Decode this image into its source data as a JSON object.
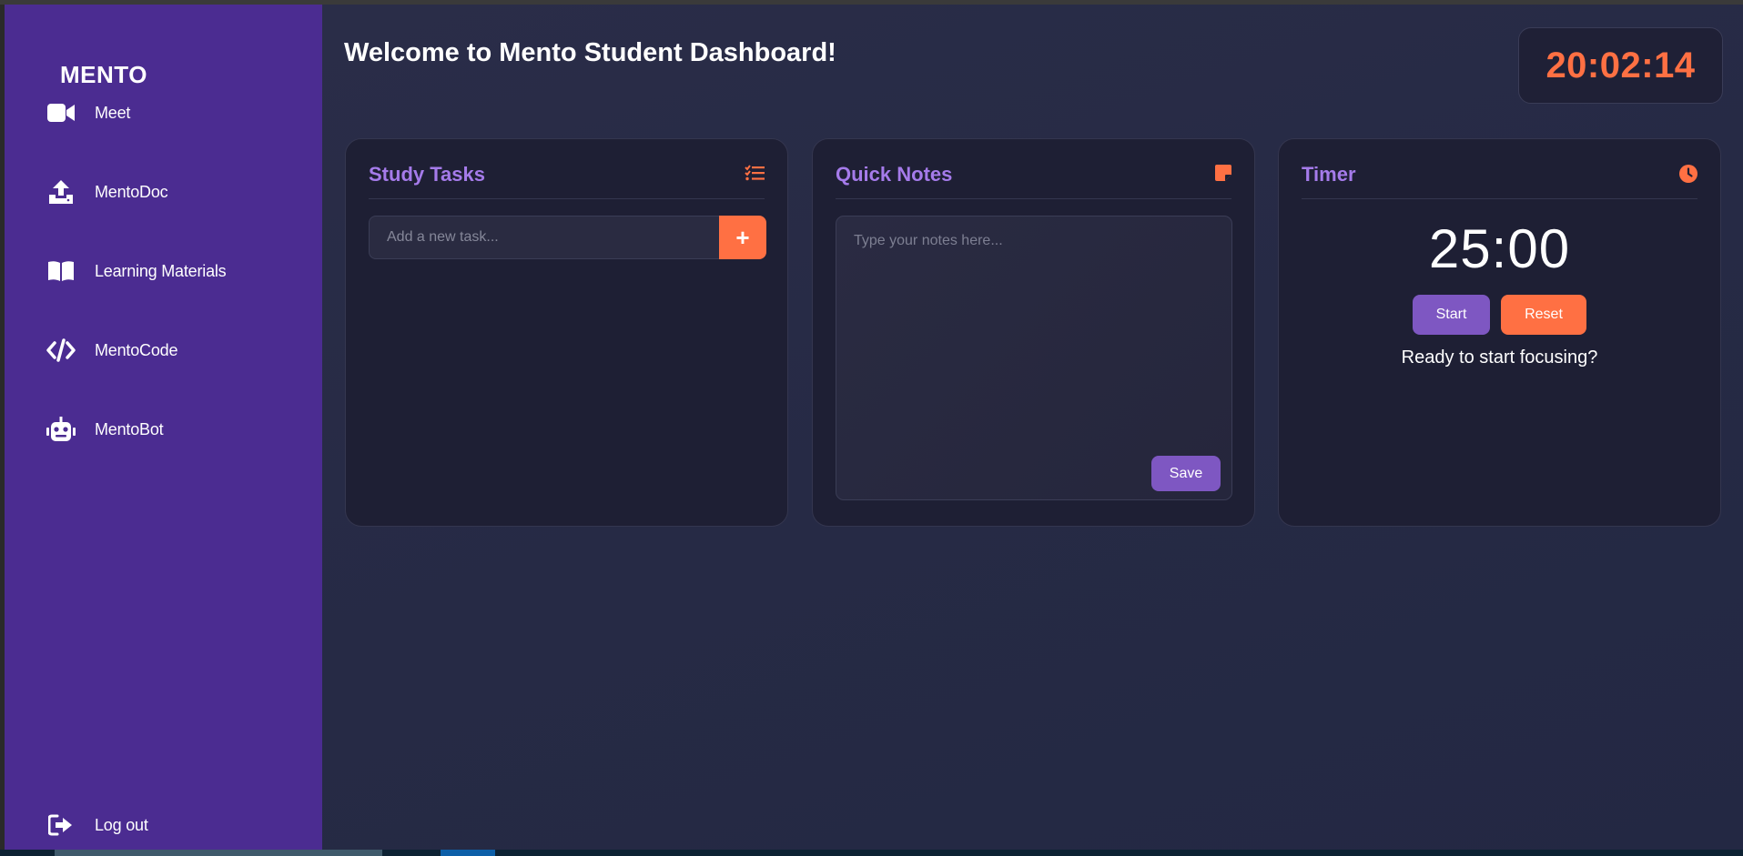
{
  "sidebar": {
    "brand": "MENTO",
    "items": [
      {
        "label": "Meet",
        "icon": "video-camera-icon"
      },
      {
        "label": "MentoDoc",
        "icon": "upload-icon"
      },
      {
        "label": "Learning Materials",
        "icon": "book-icon"
      },
      {
        "label": "MentoCode",
        "icon": "code-icon"
      },
      {
        "label": "MentoBot",
        "icon": "robot-icon"
      }
    ],
    "logout": {
      "label": "Log out",
      "icon": "sign-out-icon"
    }
  },
  "header": {
    "welcome": "Welcome to Mento Student Dashboard!",
    "clock": "20:02:14"
  },
  "tasks": {
    "title": "Study Tasks",
    "icon": "task-list-icon",
    "input_placeholder": "Add a new task...",
    "input_value": "",
    "add_label": "+",
    "items": []
  },
  "notes": {
    "title": "Quick Notes",
    "icon": "sticky-note-icon",
    "placeholder": "Type your notes here...",
    "value": "",
    "save_label": "Save"
  },
  "timer": {
    "title": "Timer",
    "icon": "clock-icon",
    "display": "25:00",
    "start_label": "Start",
    "reset_label": "Reset",
    "status": "Ready to start focusing?"
  },
  "colors": {
    "sidebar_bg": "#4b2c91",
    "accent_orange": "#ff7043",
    "accent_purple": "#7e57c2",
    "title_purple": "#a57bea",
    "card_bg": "#1e1f34"
  }
}
